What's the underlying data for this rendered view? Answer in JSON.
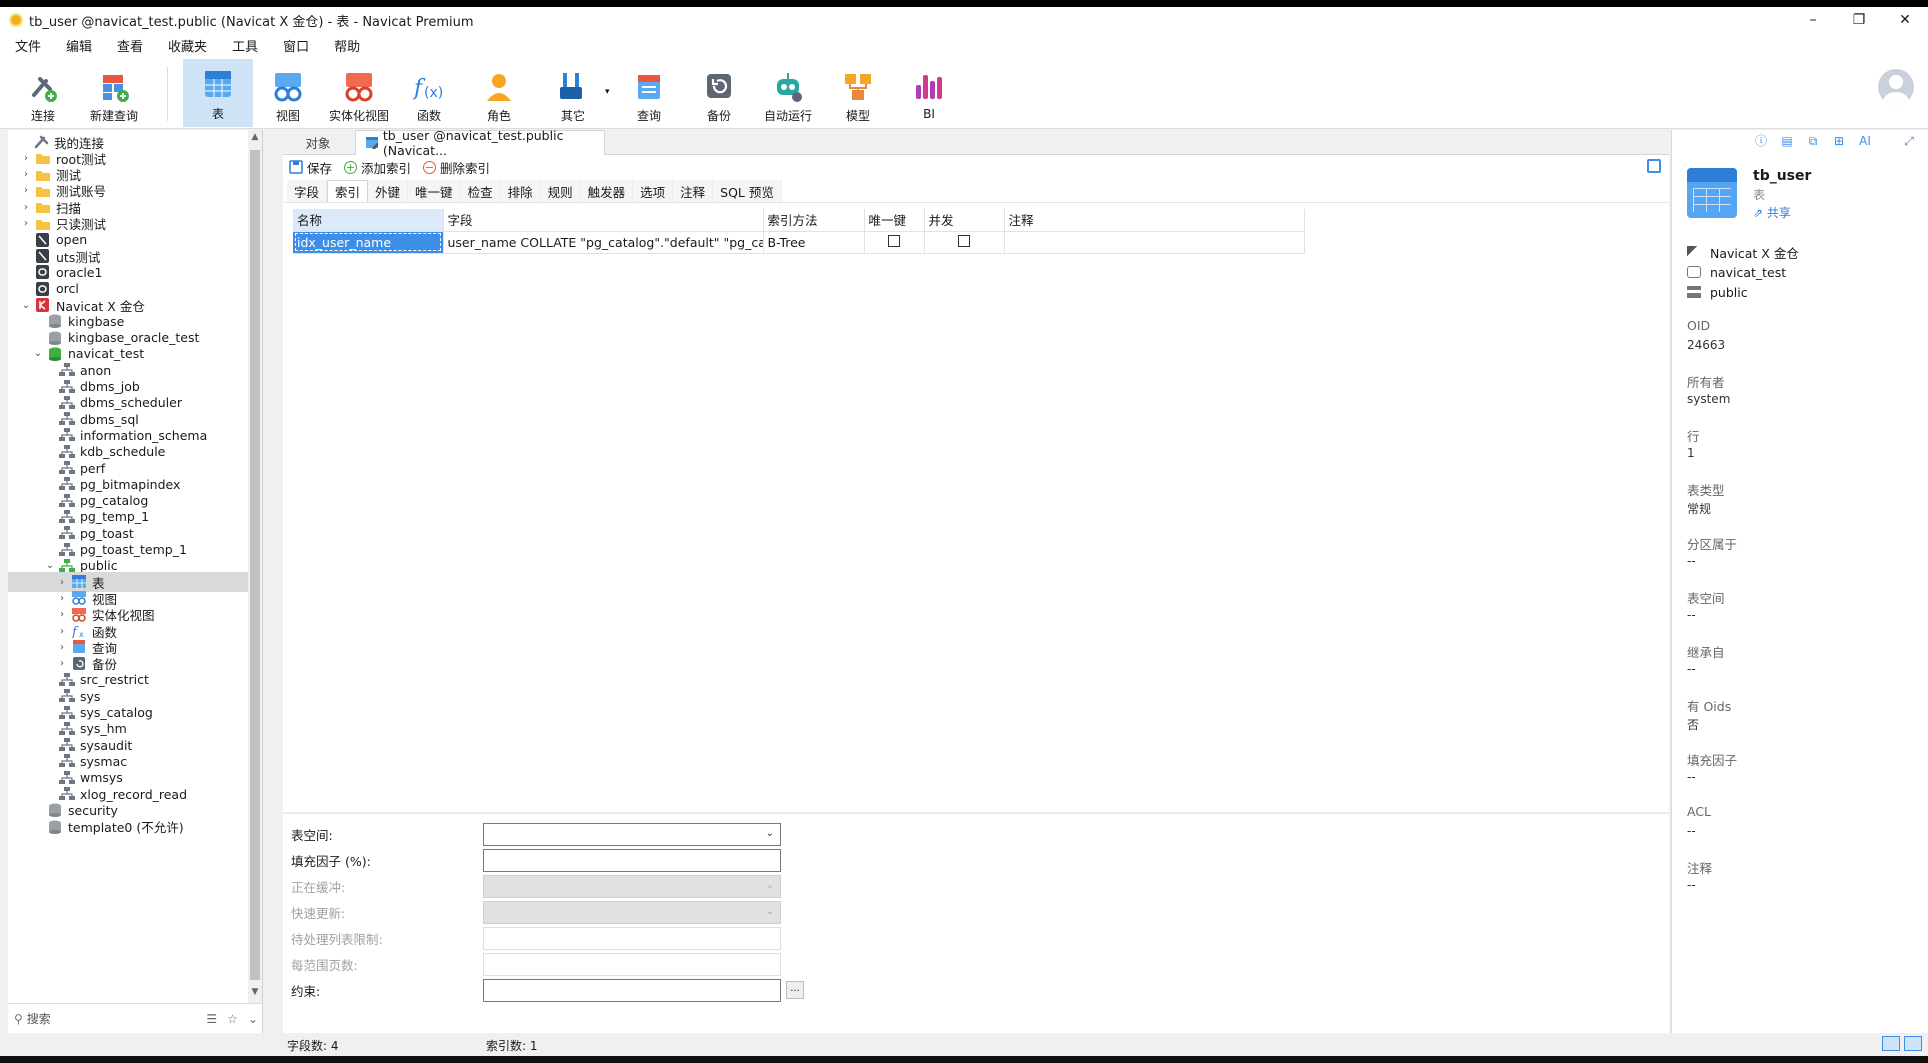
{
  "window": {
    "title": "tb_user @navicat_test.public (Navicat X 金仓) - 表 - Navicat Premium",
    "minimize": "–",
    "maximize": "❐",
    "close": "✕"
  },
  "menu": [
    "文件",
    "编辑",
    "查看",
    "收藏夹",
    "工具",
    "窗口",
    "帮助"
  ],
  "toolbar": {
    "connect": "连接",
    "new_query": "新建查询",
    "table": "表",
    "view": "视图",
    "mat_view": "实体化视图",
    "function": "函数",
    "role": "角色",
    "other": "其它",
    "query": "查询",
    "backup": "备份",
    "automation": "自动运行",
    "model": "模型",
    "bi": "BI"
  },
  "tree": [
    {
      "label": "我的连接",
      "level": 0,
      "arrow": "",
      "icon": "connections"
    },
    {
      "label": "root测试",
      "level": 1,
      "arrow": "›",
      "icon": "folder"
    },
    {
      "label": "测试",
      "level": 1,
      "arrow": "›",
      "icon": "folder"
    },
    {
      "label": "测试账号",
      "level": 1,
      "arrow": "›",
      "icon": "folder"
    },
    {
      "label": "扫描",
      "level": 1,
      "arrow": "›",
      "icon": "folder"
    },
    {
      "label": "只读测试",
      "level": 1,
      "arrow": "›",
      "icon": "folder"
    },
    {
      "label": "open",
      "level": 1,
      "arrow": "",
      "icon": "conn-dark"
    },
    {
      "label": "uts测试",
      "level": 1,
      "arrow": "",
      "icon": "conn-dark"
    },
    {
      "label": "oracle1",
      "level": 1,
      "arrow": "",
      "icon": "conn-oracle"
    },
    {
      "label": "orcl",
      "level": 1,
      "arrow": "",
      "icon": "conn-oracle"
    },
    {
      "label": "Navicat X 金仓",
      "level": 1,
      "arrow": "⌄",
      "icon": "conn-kingbase"
    },
    {
      "label": "kingbase",
      "level": 2,
      "arrow": "",
      "icon": "db-gray"
    },
    {
      "label": "kingbase_oracle_test",
      "level": 2,
      "arrow": "",
      "icon": "db-gray"
    },
    {
      "label": "navicat_test",
      "level": 2,
      "arrow": "⌄",
      "icon": "db-green"
    },
    {
      "label": "anon",
      "level": 3,
      "arrow": "",
      "icon": "schema"
    },
    {
      "label": "dbms_job",
      "level": 3,
      "arrow": "",
      "icon": "schema"
    },
    {
      "label": "dbms_scheduler",
      "level": 3,
      "arrow": "",
      "icon": "schema"
    },
    {
      "label": "dbms_sql",
      "level": 3,
      "arrow": "",
      "icon": "schema"
    },
    {
      "label": "information_schema",
      "level": 3,
      "arrow": "",
      "icon": "schema"
    },
    {
      "label": "kdb_schedule",
      "level": 3,
      "arrow": "",
      "icon": "schema"
    },
    {
      "label": "perf",
      "level": 3,
      "arrow": "",
      "icon": "schema"
    },
    {
      "label": "pg_bitmapindex",
      "level": 3,
      "arrow": "",
      "icon": "schema"
    },
    {
      "label": "pg_catalog",
      "level": 3,
      "arrow": "",
      "icon": "schema"
    },
    {
      "label": "pg_temp_1",
      "level": 3,
      "arrow": "",
      "icon": "schema"
    },
    {
      "label": "pg_toast",
      "level": 3,
      "arrow": "",
      "icon": "schema"
    },
    {
      "label": "pg_toast_temp_1",
      "level": 3,
      "arrow": "",
      "icon": "schema"
    },
    {
      "label": "public",
      "level": 3,
      "arrow": "⌄",
      "icon": "schema-green"
    },
    {
      "label": "表",
      "level": 4,
      "arrow": "›",
      "icon": "table",
      "selected": true
    },
    {
      "label": "视图",
      "level": 4,
      "arrow": "›",
      "icon": "view"
    },
    {
      "label": "实体化视图",
      "level": 4,
      "arrow": "›",
      "icon": "matview"
    },
    {
      "label": "函数",
      "level": 4,
      "arrow": "›",
      "icon": "function"
    },
    {
      "label": "查询",
      "level": 4,
      "arrow": "›",
      "icon": "query"
    },
    {
      "label": "备份",
      "level": 4,
      "arrow": "›",
      "icon": "backup"
    },
    {
      "label": "src_restrict",
      "level": 3,
      "arrow": "",
      "icon": "schema"
    },
    {
      "label": "sys",
      "level": 3,
      "arrow": "",
      "icon": "schema"
    },
    {
      "label": "sys_catalog",
      "level": 3,
      "arrow": "",
      "icon": "schema"
    },
    {
      "label": "sys_hm",
      "level": 3,
      "arrow": "",
      "icon": "schema"
    },
    {
      "label": "sysaudit",
      "level": 3,
      "arrow": "",
      "icon": "schema"
    },
    {
      "label": "sysmac",
      "level": 3,
      "arrow": "",
      "icon": "schema"
    },
    {
      "label": "wmsys",
      "level": 3,
      "arrow": "",
      "icon": "schema"
    },
    {
      "label": "xlog_record_read",
      "level": 3,
      "arrow": "",
      "icon": "schema"
    },
    {
      "label": "security",
      "level": 2,
      "arrow": "",
      "icon": "db-gray"
    },
    {
      "label": "template0 (不允许)",
      "level": 2,
      "arrow": "",
      "icon": "db-gray"
    }
  ],
  "left_search": {
    "label": "搜索"
  },
  "tabs": {
    "objects": "对象",
    "active": "tb_user @navicat_test.public (Navicat..."
  },
  "actions": {
    "save": "保存",
    "add_index": "添加索引",
    "delete_index": "删除索引"
  },
  "subtabs": [
    "字段",
    "索引",
    "外键",
    "唯一键",
    "检查",
    "排除",
    "规则",
    "触发器",
    "选项",
    "注释",
    "SQL 预览"
  ],
  "index_table": {
    "columns": [
      "名称",
      "字段",
      "索引方法",
      "唯一键",
      "并发",
      "注释"
    ],
    "rows": [
      {
        "name": "idx_user_name",
        "fields": "user_name COLLATE \"pg_catalog\".\"default\" \"pg_catalog\"",
        "method": "B-Tree",
        "unique": false,
        "concurrent": false,
        "comment": ""
      }
    ]
  },
  "props": {
    "tablespace": "表空间:",
    "fillfactor": "填充因子 (%):",
    "buffering": "正在缓冲:",
    "fastupdate": "快速更新:",
    "pending_list": "待处理列表限制:",
    "pages_per_range": "每范围页数:",
    "constraint": "约束:",
    "ellipsis": "..."
  },
  "status": {
    "field_count": "字段数: 4",
    "index_count": "索引数: 1"
  },
  "right": {
    "name": "tb_user",
    "type": "表",
    "share": "共享",
    "connection": "Navicat X 金仓",
    "database": "navicat_test",
    "schema": "public",
    "oid_label": "OID",
    "oid": "24663",
    "owner_label": "所有者",
    "owner": "system",
    "rows_label": "行",
    "rows": "1",
    "tabletype_label": "表类型",
    "tabletype": "常规",
    "partition_label": "分区属于",
    "partition": "--",
    "tablespace_label": "表空间",
    "tablespace": "--",
    "inherits_label": "继承自",
    "inherits": "--",
    "oids_label": "有 Oids",
    "oids": "否",
    "fillfactor_label": "填充因子",
    "fillfactor": "--",
    "acl_label": "ACL",
    "acl": "--",
    "comment_label": "注释",
    "comment": "--",
    "ai": "AI"
  }
}
